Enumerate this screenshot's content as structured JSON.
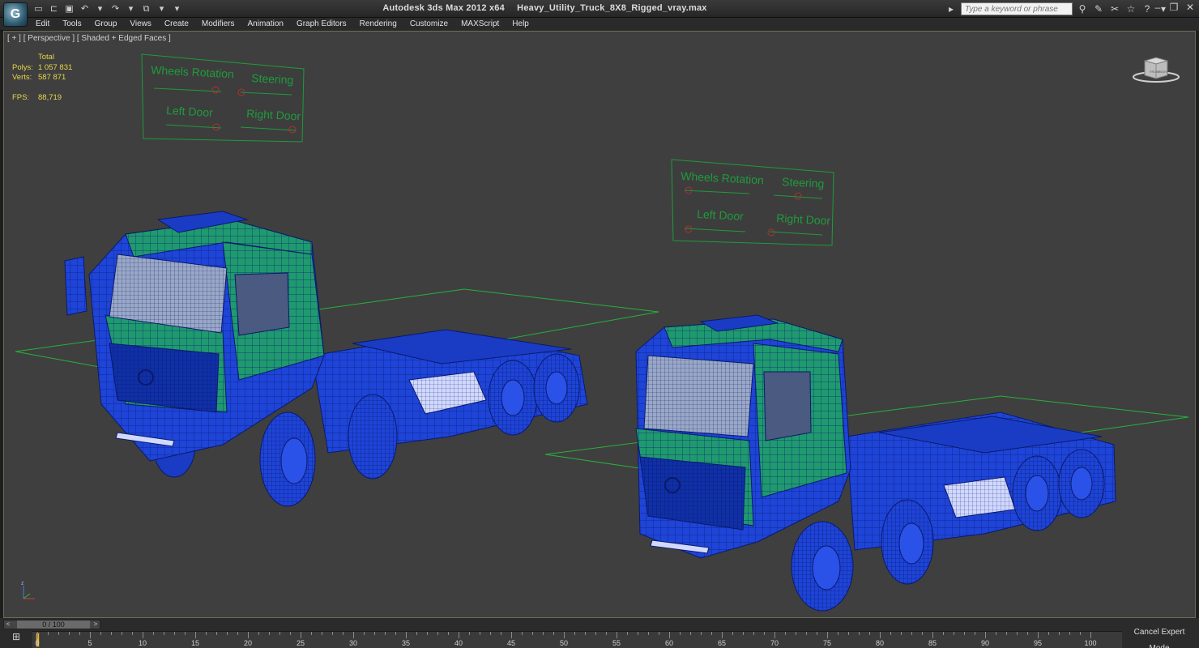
{
  "window": {
    "app_title": "Autodesk 3ds Max  2012 x64",
    "file_name": "Heavy_Utility_Truck_8X8_Rigged_vray.max",
    "search_placeholder": "Type a keyword or phrase",
    "logo_icon": "3dsmax-logo-icon"
  },
  "menu": [
    "Edit",
    "Tools",
    "Group",
    "Views",
    "Create",
    "Modifiers",
    "Animation",
    "Graph Editors",
    "Rendering",
    "Customize",
    "MAXScript",
    "Help"
  ],
  "viewport": {
    "label": "[ + ] [ Perspective ] [ Shaded + Edged Faces ]",
    "stats": {
      "total_label": "Total",
      "polys_label": "Polys:",
      "polys_value": "1 057 831",
      "verts_label": "Verts:",
      "verts_value": "587 871",
      "fps_label": "FPS:",
      "fps_value": "88,719"
    },
    "control_panels": [
      {
        "wheels": "Wheels Rotation",
        "steering": "Steering",
        "left_door": "Left Door",
        "right_door": "Right Door"
      },
      {
        "wheels": "Wheels Rotation",
        "steering": "Steering",
        "left_door": "Left Door",
        "right_door": "Right Door"
      }
    ],
    "viewcube_labels": {
      "front": "FRONT",
      "right": "RIGHT"
    },
    "axis_label": "z"
  },
  "timeline": {
    "frame_display": "0 / 100",
    "ticks": [
      "0",
      "5",
      "10",
      "15",
      "20",
      "25",
      "30",
      "35",
      "40",
      "45",
      "50",
      "55",
      "60",
      "65",
      "70",
      "75",
      "80",
      "85",
      "90",
      "95",
      "100"
    ],
    "cancel_expert_label": "Cancel Expert Mode"
  },
  "colors": {
    "wire_blue": "#1e44d8",
    "cab_green": "#1f9a6e",
    "panel_green": "#1f9b3c",
    "grid_green": "#28b03c",
    "stat_yellow": "#e8d64a"
  }
}
